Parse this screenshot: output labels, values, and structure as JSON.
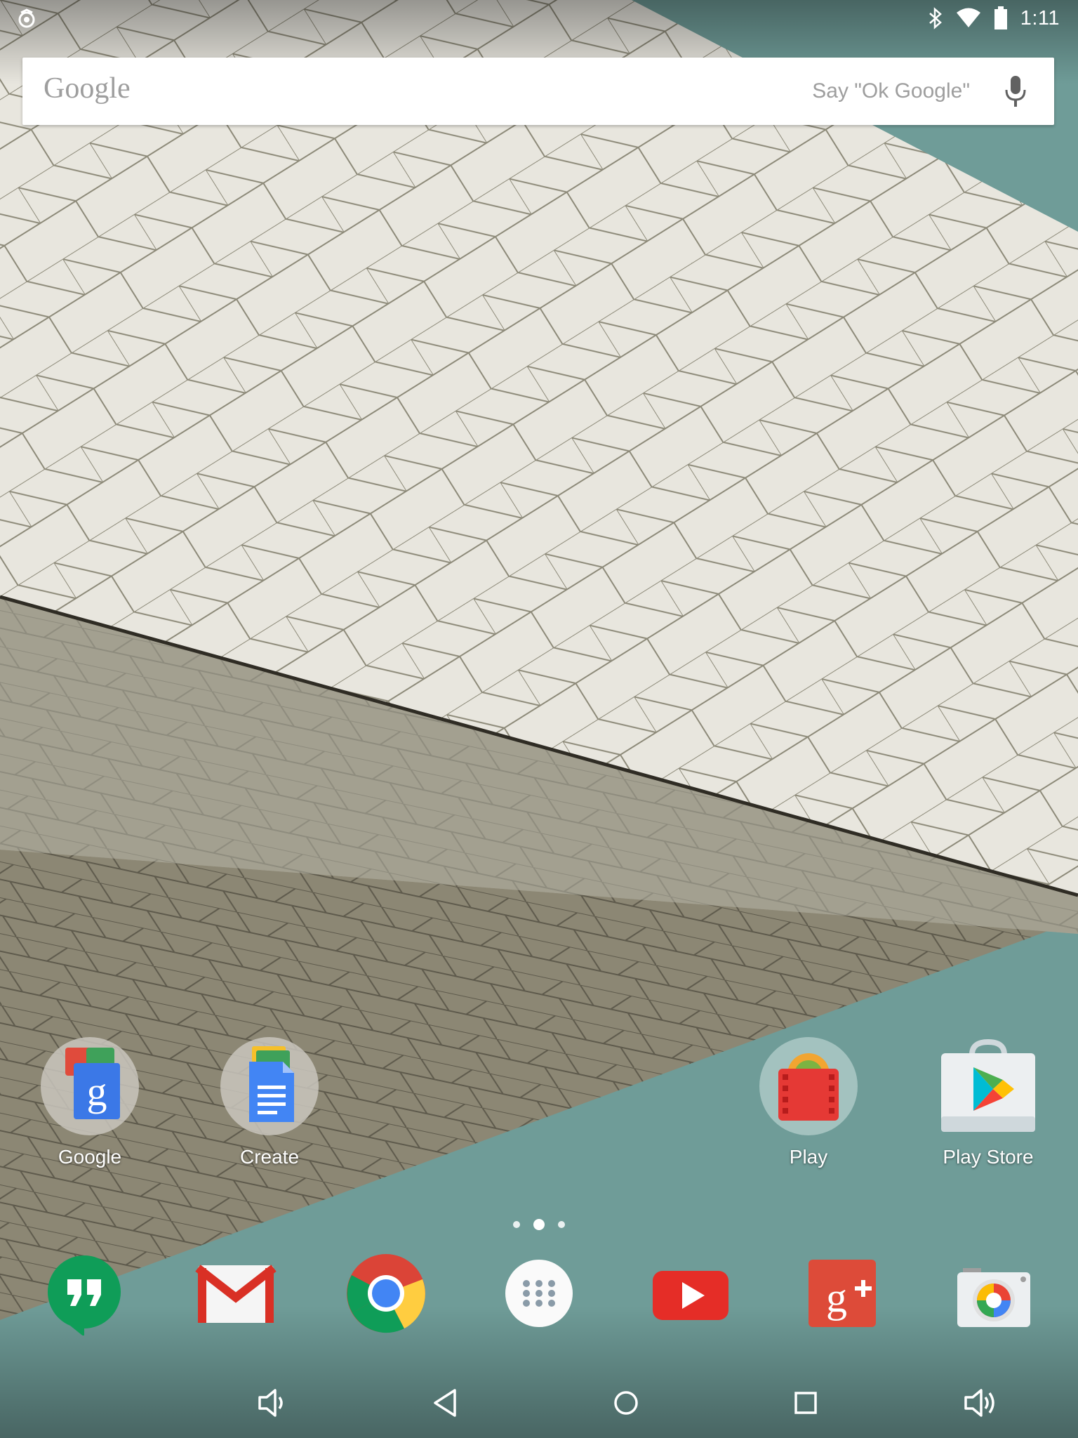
{
  "status_bar": {
    "time": "1:11",
    "icons": [
      "notification-icon",
      "bluetooth-icon",
      "wifi-icon",
      "battery-icon"
    ]
  },
  "search": {
    "logo": "Google",
    "hint": "Say \"Ok Google\"",
    "icon": "mic-icon"
  },
  "home_apps": [
    {
      "label": "Google",
      "icon": "google-folder-icon"
    },
    {
      "label": "Create",
      "icon": "docs-folder-icon"
    },
    {
      "label": "Play",
      "icon": "play-folder-icon"
    },
    {
      "label": "Play Store",
      "icon": "play-store-icon"
    }
  ],
  "pager": {
    "pages": 3,
    "current": 2
  },
  "dock": [
    "hangouts-icon",
    "gmail-icon",
    "chrome-icon",
    "app-drawer-icon",
    "youtube-icon",
    "google-plus-icon",
    "camera-icon"
  ],
  "nav_bar": [
    "volume-down-icon",
    "back-icon",
    "home-icon",
    "recents-icon",
    "volume-up-icon"
  ],
  "colors": {
    "teal": "#6f9c98",
    "tile": "#e9e7df",
    "red": "#e53935"
  }
}
